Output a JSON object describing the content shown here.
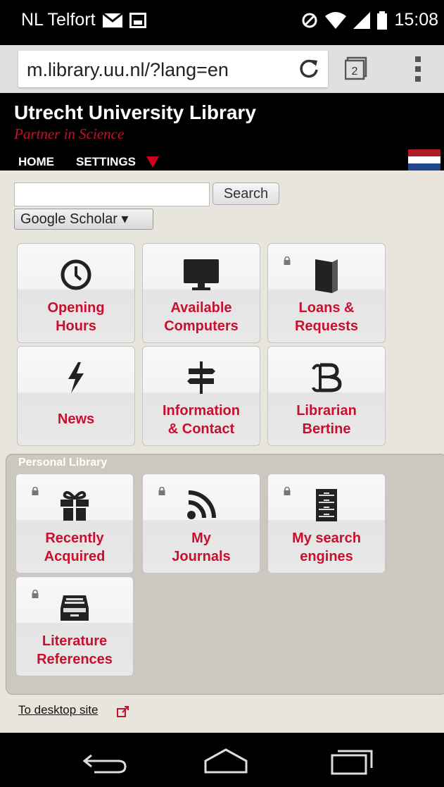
{
  "status_bar": {
    "carrier": "NL Telfort",
    "time": "15:08"
  },
  "browser": {
    "url": "m.library.uu.nl/?lang=en",
    "tab_count": "2"
  },
  "header": {
    "title": "Utrecht University Library",
    "tagline": "Partner in Science",
    "nav": {
      "home": "HOME",
      "settings": "SETTINGS"
    }
  },
  "search": {
    "button_label": "Search",
    "engine": "Google Scholar ▾",
    "input_value": ""
  },
  "tiles": [
    {
      "line1": "Opening",
      "line2": "Hours",
      "icon": "clock-icon",
      "locked": false
    },
    {
      "line1": "Available",
      "line2": "Computers",
      "icon": "monitor-icon",
      "locked": false
    },
    {
      "line1": "Loans &",
      "line2": "Requests",
      "icon": "book-icon",
      "locked": true
    },
    {
      "line1": "News",
      "line2": "",
      "icon": "lightning-icon",
      "locked": false
    },
    {
      "line1": "Information",
      "line2": "& Contact",
      "icon": "signpost-icon",
      "locked": false
    },
    {
      "line1": "Librarian",
      "line2": "Bertine",
      "icon": "bertine-logo-icon",
      "locked": false
    }
  ],
  "personal": {
    "title": "Personal Library",
    "tiles": [
      {
        "line1": "Recently",
        "line2": "Acquired",
        "icon": "gift-icon",
        "locked": true
      },
      {
        "line1": "My",
        "line2": "Journals",
        "icon": "rss-icon",
        "locked": true
      },
      {
        "line1": "My search",
        "line2": "engines",
        "icon": "cabinet-icon",
        "locked": true
      },
      {
        "line1": "Literature",
        "line2": "References",
        "icon": "inbox-tray-icon",
        "locked": true
      }
    ]
  },
  "footer": {
    "desktop_link": "To desktop site"
  },
  "colors": {
    "accent_red": "#c8102e",
    "header_bg": "#000000",
    "page_bg": "#e8e6dc"
  }
}
